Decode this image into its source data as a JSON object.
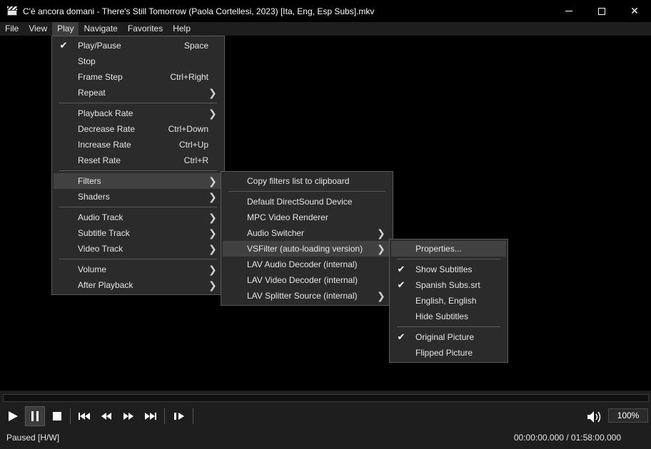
{
  "window": {
    "title": "C'è ancora domani - There's Still Tomorrow (Paola Cortellesi, 2023) [Ita, Eng, Esp Subs].mkv",
    "min_glyph": "—",
    "close_glyph": "✕"
  },
  "menubar": [
    "File",
    "View",
    "Play",
    "Navigate",
    "Favorites",
    "Help"
  ],
  "play_menu": {
    "items": [
      {
        "label": "Play/Pause",
        "accel": "Space",
        "checked": true
      },
      {
        "label": "Stop",
        "accel": ""
      },
      {
        "label": "Frame Step",
        "accel": "Ctrl+Right"
      },
      {
        "label": "Repeat",
        "submenu": true
      },
      {
        "label": "Playback Rate",
        "submenu": true
      },
      {
        "label": "Decrease Rate",
        "accel": "Ctrl+Down"
      },
      {
        "label": "Increase Rate",
        "accel": "Ctrl+Up"
      },
      {
        "label": "Reset Rate",
        "accel": "Ctrl+R"
      },
      {
        "label": "Filters",
        "submenu": true,
        "highlighted": true
      },
      {
        "label": "Shaders",
        "submenu": true
      },
      {
        "label": "Audio Track",
        "submenu": true
      },
      {
        "label": "Subtitle Track",
        "submenu": true
      },
      {
        "label": "Video Track",
        "submenu": true
      },
      {
        "label": "Volume",
        "submenu": true
      },
      {
        "label": "After Playback",
        "submenu": true
      }
    ]
  },
  "filters_menu": {
    "items": [
      {
        "label": "Copy filters list to clipboard"
      },
      {
        "label": "Default DirectSound Device"
      },
      {
        "label": "MPC Video Renderer"
      },
      {
        "label": "Audio Switcher",
        "submenu": true
      },
      {
        "label": "VSFilter (auto-loading version)",
        "submenu": true,
        "highlighted": true
      },
      {
        "label": "LAV Audio Decoder (internal)"
      },
      {
        "label": "LAV Video Decoder (internal)"
      },
      {
        "label": "LAV Splitter Source (internal)",
        "submenu": true
      }
    ]
  },
  "vsfilter_menu": {
    "items": [
      {
        "label": "Properties...",
        "highlighted": true
      },
      {
        "label": "Show Subtitles",
        "checked": true
      },
      {
        "label": "Spanish Subs.srt",
        "checked": true
      },
      {
        "label": "English, English"
      },
      {
        "label": "Hide Subtitles"
      },
      {
        "label": "Original Picture",
        "checked": true
      },
      {
        "label": "Flipped Picture"
      }
    ]
  },
  "glyphs": {
    "check": "✔",
    "arrow": "❯"
  },
  "icons": [
    "play-icon",
    "pause-icon",
    "stop-icon",
    "previous-icon",
    "rewind-icon",
    "fast-forward-icon",
    "next-icon",
    "frame-step-icon",
    "volume-icon"
  ],
  "seek": {
    "progress": 0.0
  },
  "zoom": "100%",
  "status": {
    "state": "Paused [H/W]",
    "time": "00:00:00.000 / 01:58:00.000"
  },
  "colors": {
    "accent": "#4aa3df",
    "menu_bg": "#2b2b2b",
    "highlight": "#414141"
  }
}
